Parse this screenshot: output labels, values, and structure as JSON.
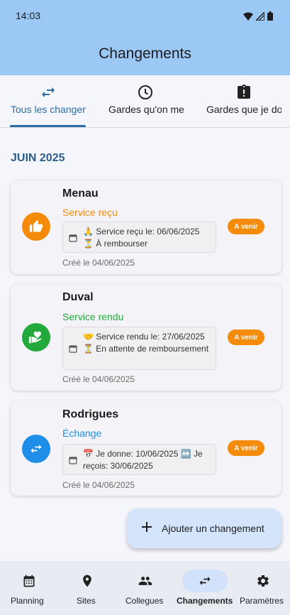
{
  "status_bar": {
    "time": "14:03"
  },
  "app_bar": {
    "title": "Changements"
  },
  "tabs": [
    {
      "label": "Tous les changements",
      "icon": "swap-horiz-icon",
      "active": true
    },
    {
      "label": "Gardes qu'on me doit",
      "icon": "clock-icon",
      "active": false
    },
    {
      "label": "Gardes que je dois",
      "icon": "clipboard-alert-icon",
      "active": false
    }
  ],
  "section": {
    "month": "JUIN 2025"
  },
  "cards": [
    {
      "name": "Menau",
      "type": "Service reçu",
      "type_color": "#f48b0a",
      "avatar_color": "#f48b0a",
      "avatar_icon": "thumbs-up-icon",
      "detail": "🙏 Service reçu le: 06/06/2025 ⏳ À rembourser",
      "created": "Créé le 04/06/2025",
      "badge": "A venir"
    },
    {
      "name": "Duval",
      "type": "Service rendu",
      "type_color": "#22a83b",
      "avatar_color": "#22a83b",
      "avatar_icon": "volunteer-heart-icon",
      "detail": "🤝 Service rendu le: 27/06/2025 ⏳ En attente de remboursement",
      "created": "Créé le 04/06/2025",
      "badge": "A venir"
    },
    {
      "name": "Rodrigues",
      "type": "Échange",
      "type_color": "#1e8ee8",
      "avatar_color": "#1e8ee8",
      "avatar_icon": "swap-horiz-icon",
      "detail": "📅 Je donne: 10/06/2025 ↔️ Je reçois: 30/06/2025",
      "created": "Créé le 04/06/2025",
      "badge": "A venir"
    }
  ],
  "fab": {
    "label": "Ajouter un changement",
    "icon": "plus-icon"
  },
  "bottom_nav": [
    {
      "label": "Planning",
      "icon": "calendar-icon",
      "active": false
    },
    {
      "label": "Sites",
      "icon": "location-pin-icon",
      "active": false
    },
    {
      "label": "Collegues",
      "icon": "people-icon",
      "active": false
    },
    {
      "label": "Changements",
      "icon": "swap-horiz-icon",
      "active": true
    },
    {
      "label": "Paramètres",
      "icon": "gear-icon",
      "active": false
    }
  ],
  "colors": {
    "header_bg": "#9bc8f5",
    "accent": "#2c6da5",
    "badge": "#f48b0a",
    "fab_bg": "#d4e5fb",
    "nav_active_pill": "#d2e2fa"
  }
}
